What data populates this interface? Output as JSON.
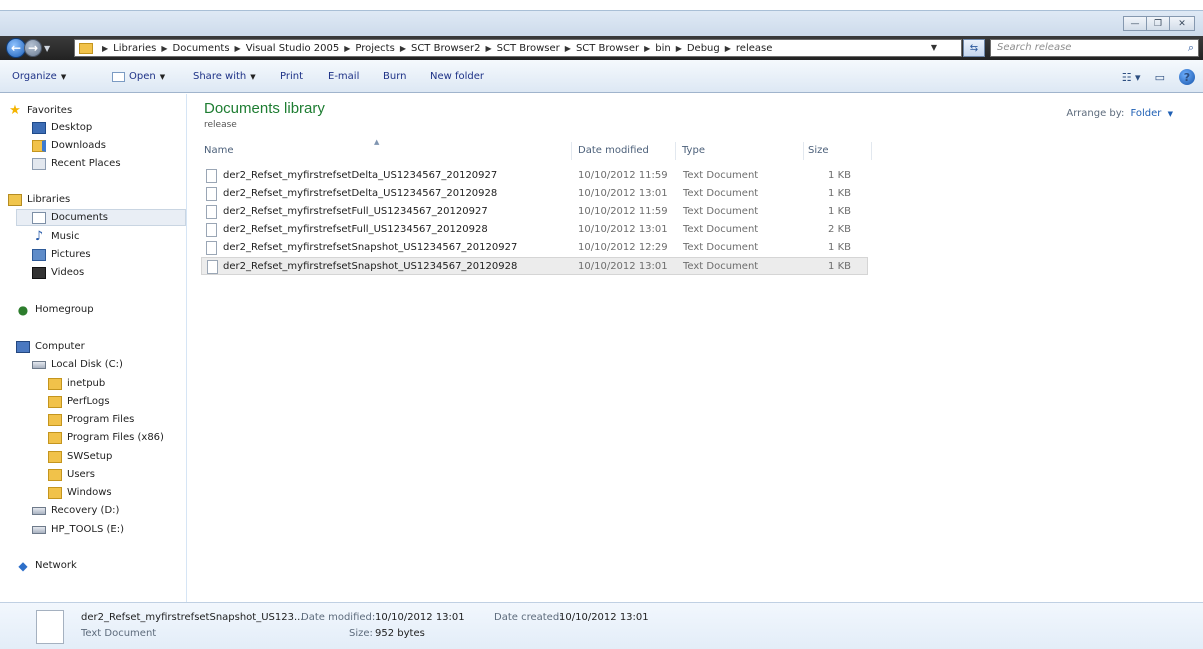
{
  "window": {
    "minimize_glyph": "—",
    "maximize_glyph": "❐",
    "close_glyph": "✕"
  },
  "address": {
    "breadcrumbs": [
      "Libraries",
      "Documents",
      "Visual Studio 2005",
      "Projects",
      "SCT Browser2",
      "SCT Browser",
      "SCT Browser",
      "bin",
      "Debug",
      "release"
    ],
    "search_placeholder": "Search release"
  },
  "toolbar": {
    "organize": "Organize",
    "open": "Open",
    "share_with": "Share with",
    "print": "Print",
    "email": "E-mail",
    "burn": "Burn",
    "new_folder": "New folder"
  },
  "nav": {
    "favorites": "Favorites",
    "desktop": "Desktop",
    "downloads": "Downloads",
    "recent_places": "Recent Places",
    "libraries": "Libraries",
    "documents": "Documents",
    "music": "Music",
    "pictures": "Pictures",
    "videos": "Videos",
    "homegroup": "Homegroup",
    "computer": "Computer",
    "local_disk": "Local Disk (C:)",
    "folders": [
      "inetpub",
      "PerfLogs",
      "Program Files",
      "Program Files (x86)",
      "SWSetup",
      "Users",
      "Windows"
    ],
    "recovery": "Recovery (D:)",
    "hp_tools": "HP_TOOLS (E:)",
    "network": "Network"
  },
  "content": {
    "library_title": "Documents library",
    "library_subtitle": "release",
    "arrange_label": "Arrange by:",
    "arrange_value": "Folder",
    "columns": {
      "name": "Name",
      "date_modified": "Date modified",
      "type": "Type",
      "size": "Size"
    },
    "files": [
      {
        "name": "der2_Refset_myfirstrefsetDelta_US1234567_20120927",
        "date": "10/10/2012 11:59",
        "type": "Text Document",
        "size": "1 KB"
      },
      {
        "name": "der2_Refset_myfirstrefsetDelta_US1234567_20120928",
        "date": "10/10/2012 13:01",
        "type": "Text Document",
        "size": "1 KB"
      },
      {
        "name": "der2_Refset_myfirstrefsetFull_US1234567_20120927",
        "date": "10/10/2012 11:59",
        "type": "Text Document",
        "size": "1 KB"
      },
      {
        "name": "der2_Refset_myfirstrefsetFull_US1234567_20120928",
        "date": "10/10/2012 13:01",
        "type": "Text Document",
        "size": "2 KB"
      },
      {
        "name": "der2_Refset_myfirstrefsetSnapshot_US1234567_20120927",
        "date": "10/10/2012 12:29",
        "type": "Text Document",
        "size": "1 KB"
      },
      {
        "name": "der2_Refset_myfirstrefsetSnapshot_US1234567_20120928",
        "date": "10/10/2012 13:01",
        "type": "Text Document",
        "size": "1 KB"
      }
    ]
  },
  "details": {
    "file_name": "der2_Refset_myfirstrefsetSnapshot_US123...",
    "file_type": "Text Document",
    "date_modified_label": "Date modified:",
    "date_modified_value": "10/10/2012 13:01",
    "size_label": "Size:",
    "size_value": "952 bytes",
    "date_created_label": "Date created:",
    "date_created_value": "10/10/2012 13:01"
  }
}
